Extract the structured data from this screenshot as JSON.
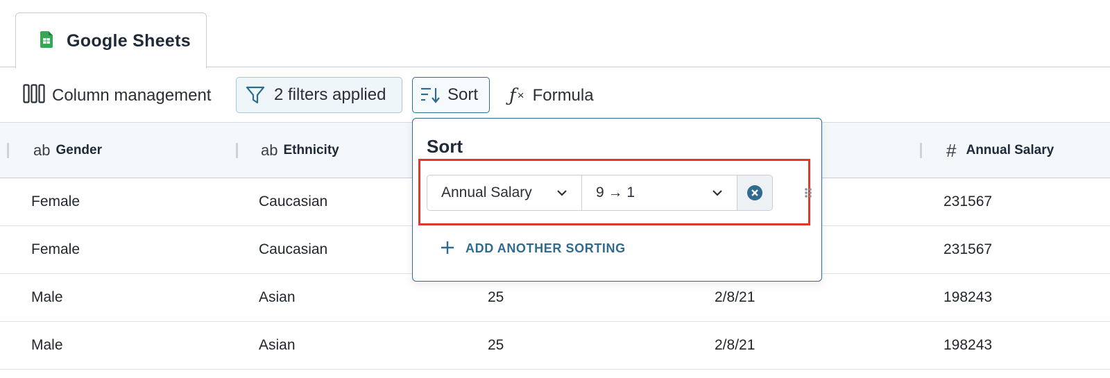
{
  "tab": {
    "label": "Google Sheets",
    "icon": "google-sheets-icon"
  },
  "toolbar": {
    "columns_label": "Column management",
    "filters_label": "2 filters applied",
    "sort_label": "Sort",
    "formula_label": "Formula",
    "formula_glyph": "ƒ",
    "formula_x": "×"
  },
  "table": {
    "columns": [
      {
        "type_glyph": "ab",
        "name": "Gender"
      },
      {
        "type_glyph": "ab",
        "name": "Ethnicity"
      },
      {
        "type_glyph": "#",
        "name": "Annual Salary"
      }
    ],
    "rows": [
      {
        "gender": "Female",
        "ethnicity": "Caucasian",
        "age": "",
        "date": "",
        "salary": "231567"
      },
      {
        "gender": "Female",
        "ethnicity": "Caucasian",
        "age": "",
        "date": "",
        "salary": "231567"
      },
      {
        "gender": "Male",
        "ethnicity": "Asian",
        "age": "25",
        "date": "2/8/21",
        "salary": "198243"
      },
      {
        "gender": "Male",
        "ethnicity": "Asian",
        "age": "25",
        "date": "2/8/21",
        "salary": "198243"
      }
    ]
  },
  "sort_popover": {
    "title": "Sort",
    "field_value": "Annual Salary",
    "order_value": "9 → 1",
    "add_label": "ADD ANOTHER SORTING"
  },
  "colors": {
    "accent": "#2f6b8e",
    "highlight": "#e0392b",
    "sheets_green": "#34a853"
  }
}
